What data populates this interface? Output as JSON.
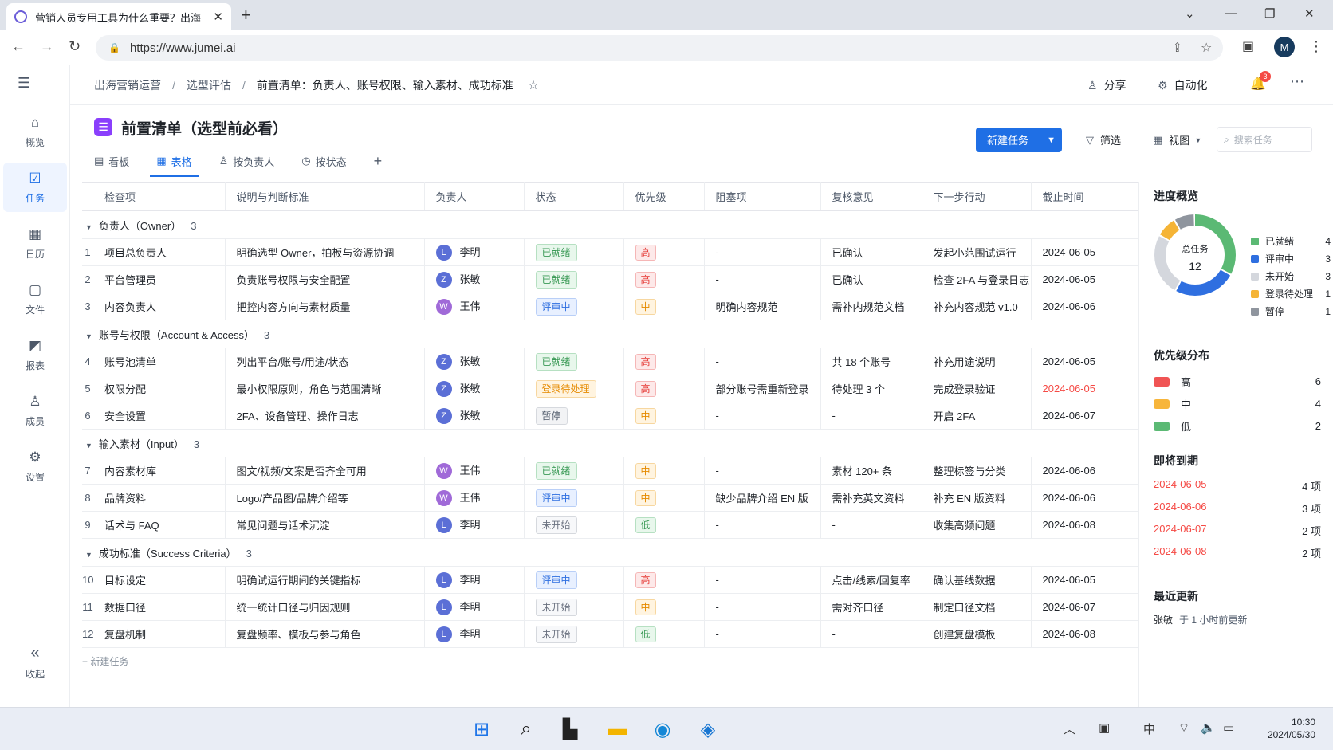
{
  "browser": {
    "tab_title": "营销人员专用工具为什么重要？出海",
    "url": "https://www.jumei.ai",
    "profile": "M"
  },
  "sidebar": [
    {
      "icon": "home-icon",
      "label": "概览"
    },
    {
      "icon": "task-icon",
      "label": "任务"
    },
    {
      "icon": "calendar-icon",
      "label": "日历"
    },
    {
      "icon": "file-icon",
      "label": "文件"
    },
    {
      "icon": "report-icon",
      "label": "报表"
    },
    {
      "icon": "member-icon",
      "label": "成员"
    },
    {
      "icon": "gear-icon",
      "label": "设置"
    }
  ],
  "sidebar_collapse": "收起",
  "breadcrumb": [
    "出海营销运营",
    "选型评估",
    "前置清单：负责人、账号权限、输入素材、成功标准"
  ],
  "topbar": {
    "share": "分享",
    "automation": "自动化",
    "notifications": "3"
  },
  "page_title": "前置清单（选型前必看）",
  "view_tabs": [
    "看板",
    "表格",
    "按负责人",
    "按状态"
  ],
  "actions": {
    "new_task": "新建任务",
    "filter": "筛选",
    "view": "视图",
    "search_placeholder": "搜索任务"
  },
  "columns": [
    "检查项",
    "说明与判断标准",
    "负责人",
    "状态",
    "优先级",
    "阻塞项",
    "复核意见",
    "下一步行动",
    "截止时间"
  ],
  "groups": [
    {
      "name": "负责人（Owner）",
      "count": "3",
      "rows": [
        {
          "idx": "1",
          "item": "项目总负责人",
          "desc": "明确选型 Owner，拍板与资源协调",
          "owner_initial": "L",
          "owner": "李明",
          "status": "已就绪",
          "priority": "高",
          "blocker": "-",
          "review": "已确认",
          "next": "发起小范围试运行",
          "due": "2024-06-05",
          "due_red": false
        },
        {
          "idx": "2",
          "item": "平台管理员",
          "desc": "负责账号权限与安全配置",
          "owner_initial": "Z",
          "owner": "张敏",
          "status": "已就绪",
          "priority": "高",
          "blocker": "-",
          "review": "已确认",
          "next": "检查 2FA 与登录日志",
          "due": "2024-06-05",
          "due_red": false
        },
        {
          "idx": "3",
          "item": "内容负责人",
          "desc": "把控内容方向与素材质量",
          "owner_initial": "W",
          "owner": "王伟",
          "status": "评审中",
          "priority": "中",
          "blocker": "明确内容规范",
          "review": "需补内规范文档",
          "next": "补充内容规范 v1.0",
          "due": "2024-06-06",
          "due_red": false
        }
      ]
    },
    {
      "name": "账号与权限（Account & Access）",
      "count": "3",
      "rows": [
        {
          "idx": "4",
          "item": "账号池清单",
          "desc": "列出平台/账号/用途/状态",
          "owner_initial": "Z",
          "owner": "张敏",
          "status": "已就绪",
          "priority": "高",
          "blocker": "-",
          "review": "共 18 个账号",
          "next": "补充用途说明",
          "due": "2024-06-05",
          "due_red": false
        },
        {
          "idx": "5",
          "item": "权限分配",
          "desc": "最小权限原则，角色与范围清晰",
          "owner_initial": "Z",
          "owner": "张敏",
          "status": "登录待处理",
          "priority": "高",
          "blocker": "部分账号需重新登录",
          "review": "待处理 3 个",
          "next": "完成登录验证",
          "due": "2024-06-05",
          "due_red": true
        },
        {
          "idx": "6",
          "item": "安全设置",
          "desc": "2FA、设备管理、操作日志",
          "owner_initial": "Z",
          "owner": "张敏",
          "status": "暂停",
          "priority": "中",
          "blocker": "-",
          "review": "-",
          "next": "开启 2FA",
          "due": "2024-06-07",
          "due_red": false
        }
      ]
    },
    {
      "name": "输入素材（Input）",
      "count": "3",
      "rows": [
        {
          "idx": "7",
          "item": "内容素材库",
          "desc": "图文/视频/文案是否齐全可用",
          "owner_initial": "W",
          "owner": "王伟",
          "status": "已就绪",
          "priority": "中",
          "blocker": "-",
          "review": "素材 120+ 条",
          "next": "整理标签与分类",
          "due": "2024-06-06",
          "due_red": false
        },
        {
          "idx": "8",
          "item": "品牌资料",
          "desc": "Logo/产品图/品牌介绍等",
          "owner_initial": "W",
          "owner": "王伟",
          "status": "评审中",
          "priority": "中",
          "blocker": "缺少品牌介绍 EN 版",
          "review": "需补充英文资料",
          "next": "补充 EN 版资料",
          "due": "2024-06-06",
          "due_red": false
        },
        {
          "idx": "9",
          "item": "话术与 FAQ",
          "desc": "常见问题与话术沉淀",
          "owner_initial": "L",
          "owner": "李明",
          "status": "未开始",
          "priority": "低",
          "blocker": "-",
          "review": "-",
          "next": "收集高频问题",
          "due": "2024-06-08",
          "due_red": false
        }
      ]
    },
    {
      "name": "成功标准（Success Criteria）",
      "count": "3",
      "rows": [
        {
          "idx": "10",
          "item": "目标设定",
          "desc": "明确试运行期间的关键指标",
          "owner_initial": "L",
          "owner": "李明",
          "status": "评审中",
          "priority": "高",
          "blocker": "-",
          "review": "点击/线索/回复率",
          "next": "确认基线数据",
          "due": "2024-06-05",
          "due_red": false
        },
        {
          "idx": "11",
          "item": "数据口径",
          "desc": "统一统计口径与归因规则",
          "owner_initial": "L",
          "owner": "李明",
          "status": "未开始",
          "priority": "中",
          "blocker": "-",
          "review": "需对齐口径",
          "next": "制定口径文档",
          "due": "2024-06-07",
          "due_red": false
        },
        {
          "idx": "12",
          "item": "复盘机制",
          "desc": "复盘频率、模板与参与角色",
          "owner_initial": "L",
          "owner": "李明",
          "status": "未开始",
          "priority": "低",
          "blocker": "-",
          "review": "-",
          "next": "创建复盘模板",
          "due": "2024-06-08",
          "due_red": false
        }
      ]
    }
  ],
  "add_task": "+ 新建任务",
  "panel": {
    "progress_title": "进度概览",
    "total_label": "总任务",
    "total": "12",
    "progress": [
      {
        "label": "已就绪",
        "count": 4,
        "color": "#5bb974"
      },
      {
        "label": "评审中",
        "count": 3,
        "color": "#2f6fe0"
      },
      {
        "label": "未开始",
        "count": 3,
        "color": "#d4d7dd"
      },
      {
        "label": "登录待处理",
        "count": 1,
        "color": "#f5b436"
      },
      {
        "label": "暂停",
        "count": 1,
        "color": "#8f959e"
      }
    ],
    "priority_title": "优先级分布",
    "priority": [
      {
        "label": "高",
        "count": "6",
        "color": "#f05454"
      },
      {
        "label": "中",
        "count": "4",
        "color": "#f7b53b"
      },
      {
        "label": "低",
        "count": "2",
        "color": "#5bb974"
      }
    ],
    "due_title": "即将到期",
    "due": [
      {
        "date": "2024-06-05",
        "count": "4 项"
      },
      {
        "date": "2024-06-06",
        "count": "3 项"
      },
      {
        "date": "2024-06-07",
        "count": "2 项"
      },
      {
        "date": "2024-06-08",
        "count": "2 项"
      }
    ],
    "recent_title": "最近更新",
    "recent_user": "张敏",
    "recent_text": "于 1 小时前更新"
  },
  "taskbar": {
    "ime": "中",
    "time": "10:30",
    "date": "2024/05/30"
  }
}
